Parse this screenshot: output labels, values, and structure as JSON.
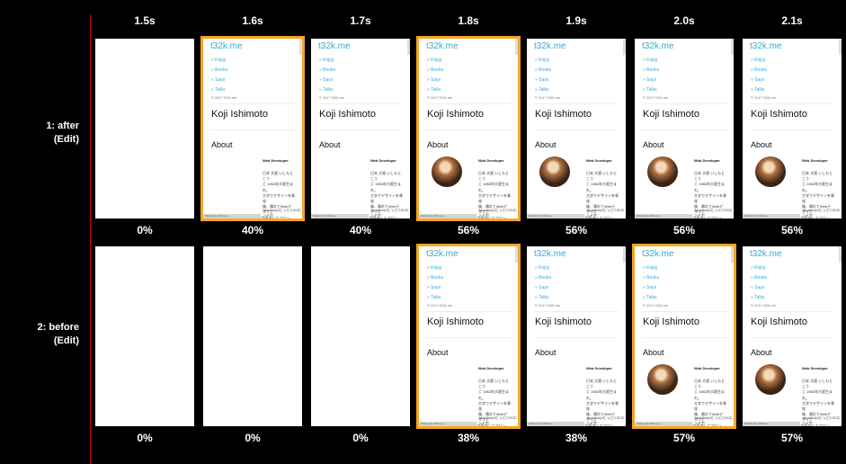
{
  "timeline": [
    "1.5s",
    "1.6s",
    "1.7s",
    "1.8s",
    "1.9s",
    "2.0s",
    "2.1s"
  ],
  "rows": [
    {
      "label": "1: after",
      "edit": "(Edit)",
      "frames": [
        {
          "state": "blank",
          "percent": "0%"
        },
        {
          "state": "page",
          "changed": true,
          "percent": "40%",
          "avatar": false
        },
        {
          "state": "page",
          "changed": false,
          "percent": "40%",
          "avatar": false
        },
        {
          "state": "page",
          "changed": true,
          "percent": "56%",
          "avatar": true
        },
        {
          "state": "page",
          "changed": false,
          "percent": "56%",
          "avatar": true
        },
        {
          "state": "page",
          "changed": false,
          "percent": "56%",
          "avatar": true
        },
        {
          "state": "page",
          "changed": false,
          "percent": "56%",
          "avatar": true
        }
      ]
    },
    {
      "label": "2: before",
      "edit": "(Edit)",
      "frames": [
        {
          "state": "blank",
          "percent": "0%"
        },
        {
          "state": "blank",
          "percent": "0%"
        },
        {
          "state": "blank",
          "percent": "0%"
        },
        {
          "state": "page",
          "changed": true,
          "percent": "38%",
          "avatar": false
        },
        {
          "state": "page",
          "changed": false,
          "percent": "38%",
          "avatar": false
        },
        {
          "state": "page",
          "changed": true,
          "percent": "57%",
          "avatar": true
        },
        {
          "state": "page",
          "changed": false,
          "percent": "57%",
          "avatar": true
        }
      ]
    }
  ],
  "page": {
    "logo": "t32k.me",
    "nav": [
      "» Kojiyj",
      "» Books",
      "» Says",
      "» Talks"
    ],
    "copyright": "© 2017 t32k.me",
    "name": "Koji Ishimoto",
    "about": "About",
    "role": "Web Developer",
    "bio_lines": [
      "日本 大阪 いしもとこう",
      "じ 1983年大阪生まれ。",
      "大学でデザインを専攻",
      "後、晴れてWebデザイナ",
      "ーとなるが、コーディング技術が面白くてフロン",
      "トエンド。主業な業務として"
    ],
    "status_text": "Waiting for t32k.me...",
    "status_tail": "JavaScriptとっとCSSエンド世"
  },
  "colors": {
    "highlight": "#f5a623",
    "divider": "#cc0000",
    "link": "#39a9d6"
  }
}
